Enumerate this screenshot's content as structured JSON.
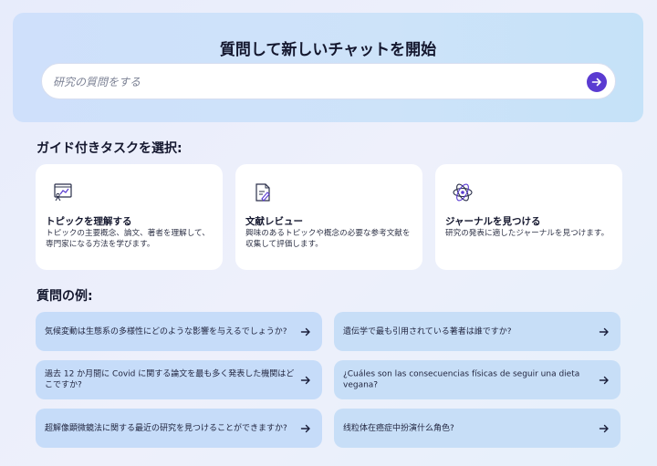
{
  "hero": {
    "title": "質問して新しいチャットを開始",
    "search_placeholder": "研究の質問をする",
    "send_icon": "arrow-right-icon",
    "accent_color": "#5a3bd1"
  },
  "tasks_section": {
    "title": "ガイド付きタスクを選択:",
    "cards": [
      {
        "icon": "presentation-board-icon",
        "title": "トピックを理解する",
        "description": "トピックの主要概念、論文、著者を理解して、専門家になる方法を学びます。"
      },
      {
        "icon": "document-pen-icon",
        "title": "文献レビュー",
        "description": "興味のあるトピックや概念の必要な参考文献を収集して評価します。"
      },
      {
        "icon": "atom-icon",
        "title": "ジャーナルを見つける",
        "description": "研究の発表に適したジャーナルを見つけます。"
      }
    ]
  },
  "examples_section": {
    "title": "質問の例:",
    "questions": [
      "気候変動は生態系の多様性にどのような影響を与えるでしょうか?",
      "遺伝学で最も引用されている著者は誰ですか?",
      "過去 12 か月間に Covid に関する論文を最も多く発表した機関はどこですか?",
      "¿Cuáles son las consecuencias físicas de seguir una dieta vegana?",
      "超解像顕微鏡法に関する最近の研究を見つけることができますか?",
      "线粒体在癌症中扮演什么角色?"
    ]
  }
}
